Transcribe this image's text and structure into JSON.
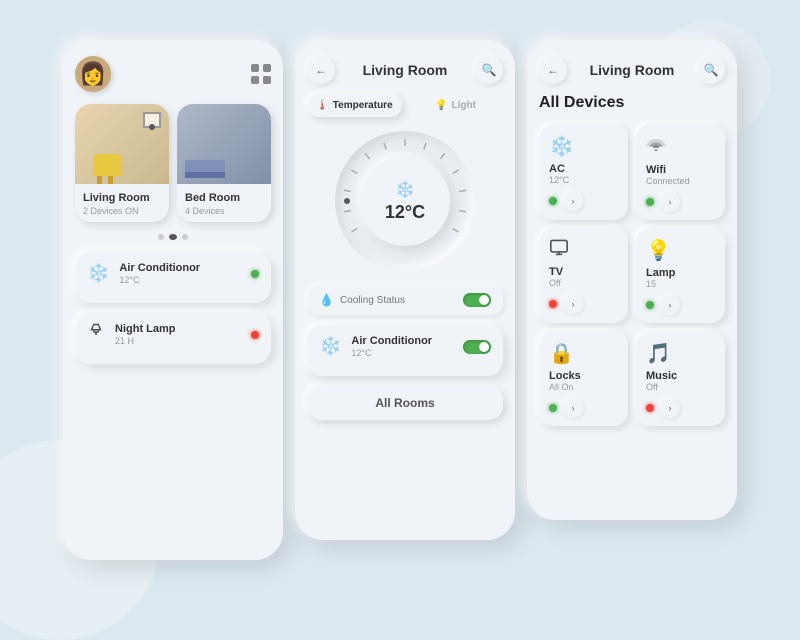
{
  "background": {
    "color": "#dce8f0"
  },
  "phone1": {
    "rooms": [
      {
        "name": "Living Room",
        "sub": "2 Devices ON",
        "type": "living"
      },
      {
        "name": "Bed Room",
        "sub": "4 Devices",
        "type": "bed"
      }
    ],
    "devices": [
      {
        "icon": "❄️",
        "name": "Air Conditionor",
        "sub": "12°C",
        "status": "green"
      },
      {
        "icon": "💡",
        "name": "Night Lamp",
        "sub": "21 H",
        "status": "red"
      }
    ]
  },
  "phone2": {
    "title": "Living Room",
    "tabs": [
      {
        "label": "Temperature",
        "icon": "🌡️",
        "active": true
      },
      {
        "label": "Light",
        "icon": "💡",
        "active": false
      }
    ],
    "thermostat": {
      "temp": "12°C",
      "icon": "❄️"
    },
    "cooling": {
      "label": "Cooling Status",
      "status": true
    },
    "aircon": {
      "icon": "❄️",
      "name": "Air Conditionor",
      "sub": "12°C",
      "status": true
    },
    "allRoomsLabel": "All Rooms"
  },
  "phone3": {
    "title": "Living Room",
    "sectionTitle": "All Devices",
    "devices": [
      {
        "icon": "❄️",
        "name": "AC",
        "sub": "12°C",
        "status": "green"
      },
      {
        "icon": "📶",
        "name": "Wifi",
        "sub": "Connected",
        "status": "green"
      },
      {
        "icon": "📺",
        "name": "TV",
        "sub": "Off",
        "status": "red"
      },
      {
        "icon": "💡",
        "name": "Lamp",
        "sub": "15",
        "status": "green"
      },
      {
        "icon": "🔒",
        "name": "Locks",
        "sub": "All On",
        "status": "green"
      },
      {
        "icon": "🎵",
        "name": "Music",
        "sub": "Off",
        "status": "red"
      }
    ]
  }
}
